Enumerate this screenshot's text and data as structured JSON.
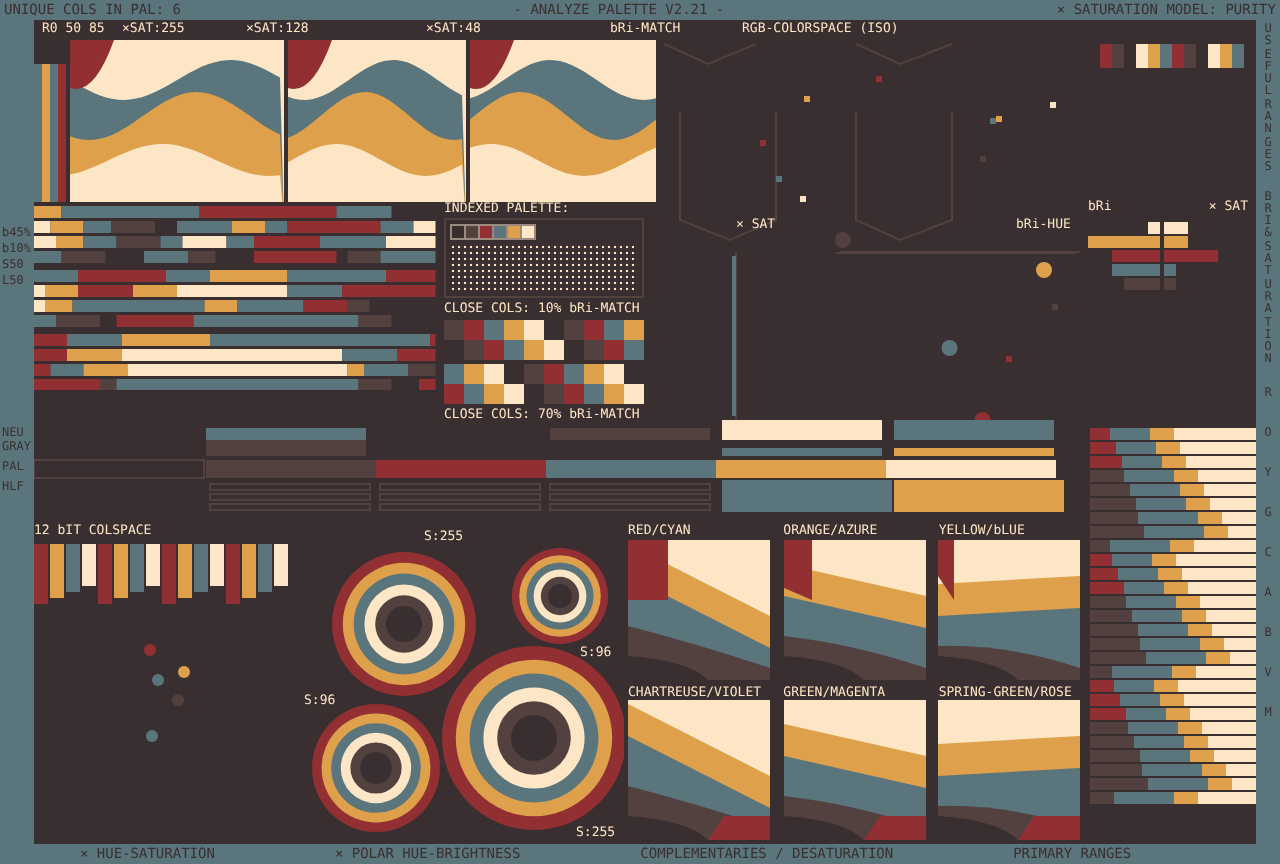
{
  "header": {
    "left": "UNIQUE COLS IN PAL: 6",
    "title": "- ANALYZE PALETTE V2.21 -",
    "right": "× SATURATION MODEL: PURITY"
  },
  "palette": [
    {
      "color": "#3a2f30"
    },
    {
      "color": "#52413f"
    },
    {
      "color": "#922f32"
    },
    {
      "color": "#5a767c"
    },
    {
      "color": "#dfa04b"
    },
    {
      "color": "#fde6c5"
    }
  ],
  "subheader": [
    "R0 50 85",
    "×SAT:255",
    "×SAT:128",
    "×SAT:48",
    "bRi-MATCH",
    "RGB-COLORSPACE (ISO)"
  ],
  "side_labels": [
    "USEFUL RANGES",
    "BRI & SATURATION"
  ],
  "row_labels": [
    "b45%",
    "b10%",
    "S50",
    "L50"
  ],
  "indexed_palette": {
    "title": "INDEXED PALETTE:",
    "close_cols": [
      "CLOSE COLS: 10% bRi-MATCH",
      "CLOSE COLS: 70% bRi-MATCH"
    ]
  },
  "colorspace": {
    "sat_label": "× SAT",
    "bri_hue_label": "bRi-HUE"
  },
  "bri_sat": {
    "bri_label": "bRi",
    "sat_label": "× SAT"
  },
  "strip_labels": [
    "NEU GRAY",
    "PAL",
    "HLF"
  ],
  "colspace_12bit": {
    "title": "12 bIT COLSPACE"
  },
  "polar": {
    "labels": [
      "S:255",
      "S:96",
      "S:96",
      "S:255"
    ]
  },
  "complementaries": [
    {
      "label": "RED/CYAN"
    },
    {
      "label": "ORANGE/AZURE"
    },
    {
      "label": "YELLOW/bLUE"
    },
    {
      "label": "CHARTREUSE/VIOLET"
    },
    {
      "label": "GREEN/MAGENTA"
    },
    {
      "label": "SPRING-GREEN/ROSE"
    }
  ],
  "primary_ranges": [
    "R",
    "O",
    "Y",
    "G",
    "C",
    "A",
    "B",
    "V",
    "M"
  ],
  "footer": [
    "× HUE-SATURATION",
    "× POLAR HUE-BRIGHTNESS",
    "COMPLEMENTARIES / DESATURATION",
    "PRIMARY RANGES"
  ]
}
